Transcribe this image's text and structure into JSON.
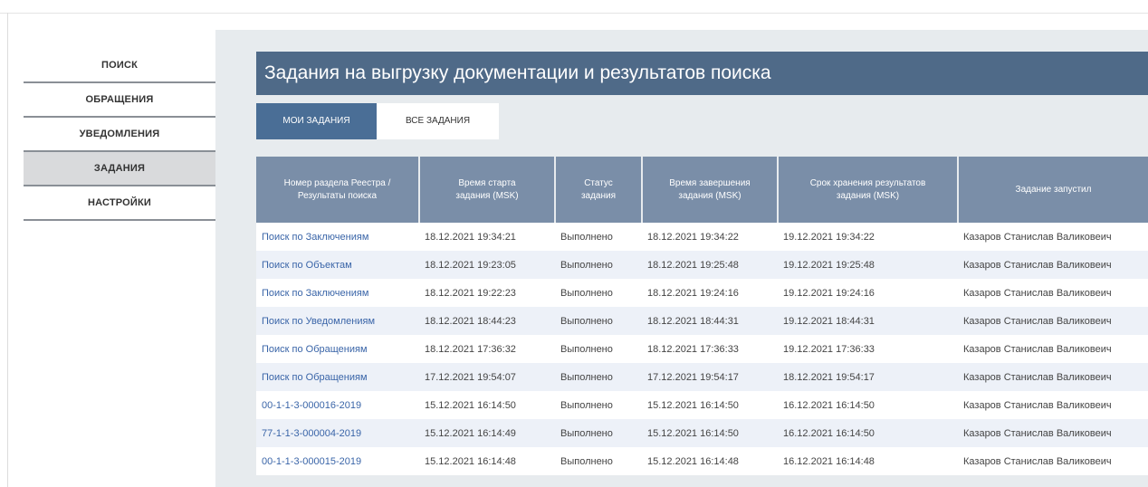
{
  "sidebar": {
    "items": [
      {
        "label": "ПОИСК",
        "active": false
      },
      {
        "label": "ОБРАЩЕНИЯ",
        "active": false
      },
      {
        "label": "УВЕДОМЛЕНИЯ",
        "active": false
      },
      {
        "label": "ЗАДАНИЯ",
        "active": true
      },
      {
        "label": "НАСТРОЙКИ",
        "active": false
      }
    ]
  },
  "main": {
    "title": "Задания на выгрузку документации и результатов поиска",
    "tabs": [
      {
        "label": "МОИ ЗАДАНИЯ",
        "active": true
      },
      {
        "label": "ВСЕ ЗАДАНИЯ",
        "active": false
      }
    ],
    "table": {
      "columns": [
        "Номер раздела Реестра /\nРезультаты поиска",
        "Время старта\nзадания (MSK)",
        "Статус\nзадания",
        "Время завершения\nзадания (MSK)",
        "Срок хранения результатов\nзадания (MSK)",
        "Задание запустил"
      ],
      "rows": [
        [
          "Поиск по Заключениям",
          "18.12.2021 19:34:21",
          "Выполнено",
          "18.12.2021 19:34:22",
          "19.12.2021 19:34:22",
          "Казаров Станислав Валиковеич"
        ],
        [
          "Поиск по Объектам",
          "18.12.2021 19:23:05",
          "Выполнено",
          "18.12.2021 19:25:48",
          "19.12.2021 19:25:48",
          "Казаров Станислав Валиковеич"
        ],
        [
          "Поиск по Заключениям",
          "18.12.2021 19:22:23",
          "Выполнено",
          "18.12.2021 19:24:16",
          "19.12.2021 19:24:16",
          "Казаров Станислав Валиковеич"
        ],
        [
          "Поиск по Уведомлениям",
          "18.12.2021 18:44:23",
          "Выполнено",
          "18.12.2021 18:44:31",
          "19.12.2021 18:44:31",
          "Казаров Станислав Валиковеич"
        ],
        [
          "Поиск по Обращениям",
          "18.12.2021 17:36:32",
          "Выполнено",
          "18.12.2021 17:36:33",
          "19.12.2021 17:36:33",
          "Казаров Станислав Валиковеич"
        ],
        [
          "Поиск по Обращениям",
          "17.12.2021 19:54:07",
          "Выполнено",
          "17.12.2021 19:54:17",
          "18.12.2021 19:54:17",
          "Казаров Станислав Валиковеич"
        ],
        [
          "00-1-1-3-000016-2019",
          "15.12.2021 16:14:50",
          "Выполнено",
          "15.12.2021 16:14:50",
          "16.12.2021 16:14:50",
          "Казаров Станислав Валиковеич"
        ],
        [
          "77-1-1-3-000004-2019",
          "15.12.2021 16:14:49",
          "Выполнено",
          "15.12.2021 16:14:50",
          "16.12.2021 16:14:50",
          "Казаров Станислав Валиковеич"
        ],
        [
          "00-1-1-3-000015-2019",
          "15.12.2021 16:14:48",
          "Выполнено",
          "15.12.2021 16:14:48",
          "16.12.2021 16:14:48",
          "Казаров Станислав Валиковеич"
        ]
      ]
    }
  }
}
